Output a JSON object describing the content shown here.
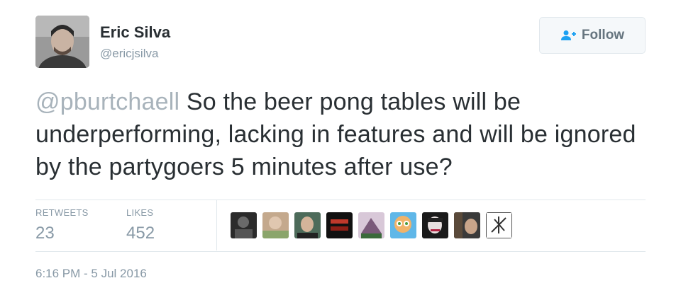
{
  "author": {
    "name": "Eric Silva",
    "handle": "@ericjsilva"
  },
  "follow_button": {
    "label": "Follow",
    "icon": "add-user-icon"
  },
  "tweet": {
    "mention": "@pburtchaell",
    "text": " So the beer pong tables will be underperforming, lacking in features and will be ignored by the partygoers 5 minutes after use?"
  },
  "stats": {
    "retweets_label": "RETWEETS",
    "retweets_count": "23",
    "likes_label": "LIKES",
    "likes_count": "452"
  },
  "timestamp": "6:16 PM - 5 Jul 2016",
  "colors": {
    "text": "#292f33",
    "muted": "#8899a6",
    "mention": "#a8b3bb",
    "border": "#e1e8ed",
    "button_bg": "#f5f8fa"
  }
}
